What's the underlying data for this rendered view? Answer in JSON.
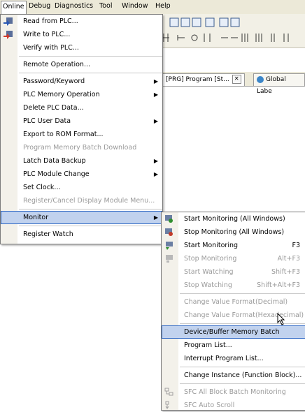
{
  "menubar": {
    "items": [
      "Online",
      "Debug",
      "Diagnostics",
      "Tool",
      "Window",
      "Help"
    ]
  },
  "tabs": [
    {
      "label": "[PRG] Program [St..."
    },
    {
      "label": "Global Labe"
    }
  ],
  "online_menu": {
    "items": [
      {
        "label": "Read from PLC...",
        "icon": "read-from-plc-icon"
      },
      {
        "label": "Write to PLC...",
        "icon": "write-to-plc-icon"
      },
      {
        "label": "Verify with PLC..."
      },
      {
        "label": "Remote Operation..."
      },
      {
        "label": "Password/Keyword"
      },
      {
        "label": "PLC Memory Operation"
      },
      {
        "label": "Delete PLC Data..."
      },
      {
        "label": "PLC User Data"
      },
      {
        "label": "Export to ROM Format..."
      },
      {
        "label": "Program Memory Batch Download"
      },
      {
        "label": "Latch Data Backup"
      },
      {
        "label": "PLC Module Change"
      },
      {
        "label": "Set Clock..."
      },
      {
        "label": "Register/Cancel Display Module Menu..."
      },
      {
        "label": "Monitor"
      },
      {
        "label": "Register Watch"
      }
    ]
  },
  "monitor_menu": {
    "items": [
      {
        "label": "Start Monitoring (All Windows)",
        "shortcut": ""
      },
      {
        "label": "Stop Monitoring (All Windows)",
        "shortcut": ""
      },
      {
        "label": "Start Monitoring",
        "shortcut": "F3"
      },
      {
        "label": "Stop Monitoring",
        "shortcut": "Alt+F3"
      },
      {
        "label": "Start Watching",
        "shortcut": "Shift+F3"
      },
      {
        "label": "Stop Watching",
        "shortcut": "Shift+Alt+F3"
      },
      {
        "label": "Change Value Format(Decimal)"
      },
      {
        "label": "Change Value Format(Hexadecimal)"
      },
      {
        "label": "Device/Buffer Memory Batch"
      },
      {
        "label": "Program List..."
      },
      {
        "label": "Interrupt Program List..."
      },
      {
        "label": "Change Instance (Function Block)..."
      },
      {
        "label": "SFC All Block Batch Monitoring"
      },
      {
        "label": "SFC Auto Scroll"
      }
    ]
  },
  "colors": {
    "highlight_bg": "#c1d2ee",
    "highlight_border": "#316ac5",
    "disabled_text": "#9a9a9a"
  }
}
